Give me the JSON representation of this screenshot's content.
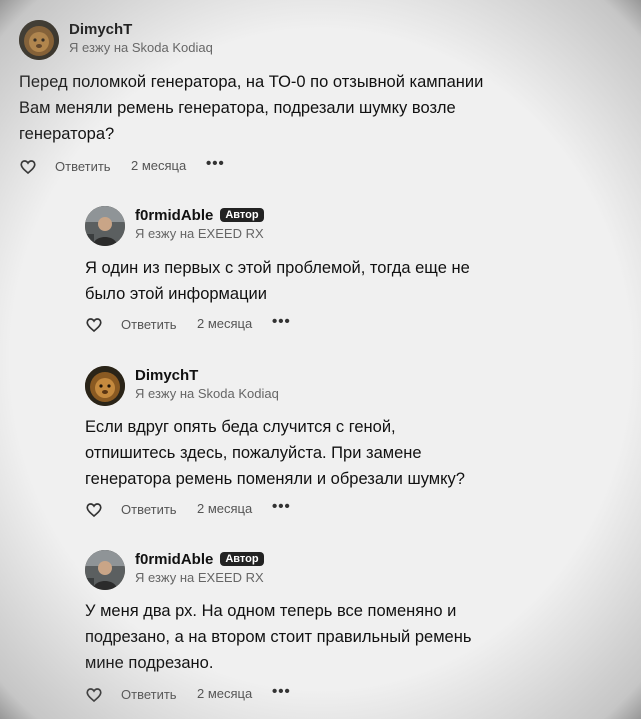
{
  "comments": [
    {
      "author": "DimychT",
      "badge": "",
      "car": "Я езжу на Skoda Kodiaq",
      "lines": [
        "Перед поломкой генератора, на ТО-0 по отзывной кампании",
        "Вам меняли ремень генератора, подрезали шумку возле",
        "генератора?"
      ],
      "reply_label": "Ответить",
      "date": "2 месяца",
      "avatar": "lion-avatar"
    },
    {
      "author": "f0rmidAble",
      "badge": "Автор",
      "car": "Я езжу на EXEED RX",
      "lines": [
        "Я один из первых с этой проблемой, тогда еще не",
        "было этой информации"
      ],
      "reply_label": "Ответить",
      "date": "2 месяца",
      "avatar": "car-person-avatar"
    },
    {
      "author": "DimychT",
      "badge": "",
      "car": "Я езжу на Skoda Kodiaq",
      "lines": [
        "Если вдруг опять беда случится с геной,",
        "отпишитесь здесь, пожалуйста. При замене",
        "генератора ремень поменяли и обрезали шумку?"
      ],
      "reply_label": "Ответить",
      "date": "2 месяца",
      "avatar": "lion-avatar"
    },
    {
      "author": "f0rmidAble",
      "badge": "Автор",
      "car": "Я езжу на EXEED RX",
      "lines": [
        "У меня два рх. На одном теперь все поменяно и",
        "подрезано, а на втором стоит правильный ремень",
        "мине подрезано."
      ],
      "reply_label": "Ответить",
      "date": "2 месяца",
      "avatar": "car-person-avatar"
    }
  ],
  "icons": {
    "like": "heart-icon",
    "more": "more-dots-icon"
  },
  "colors": {
    "badge_bg": "#222222",
    "meta_text": "#666666"
  }
}
